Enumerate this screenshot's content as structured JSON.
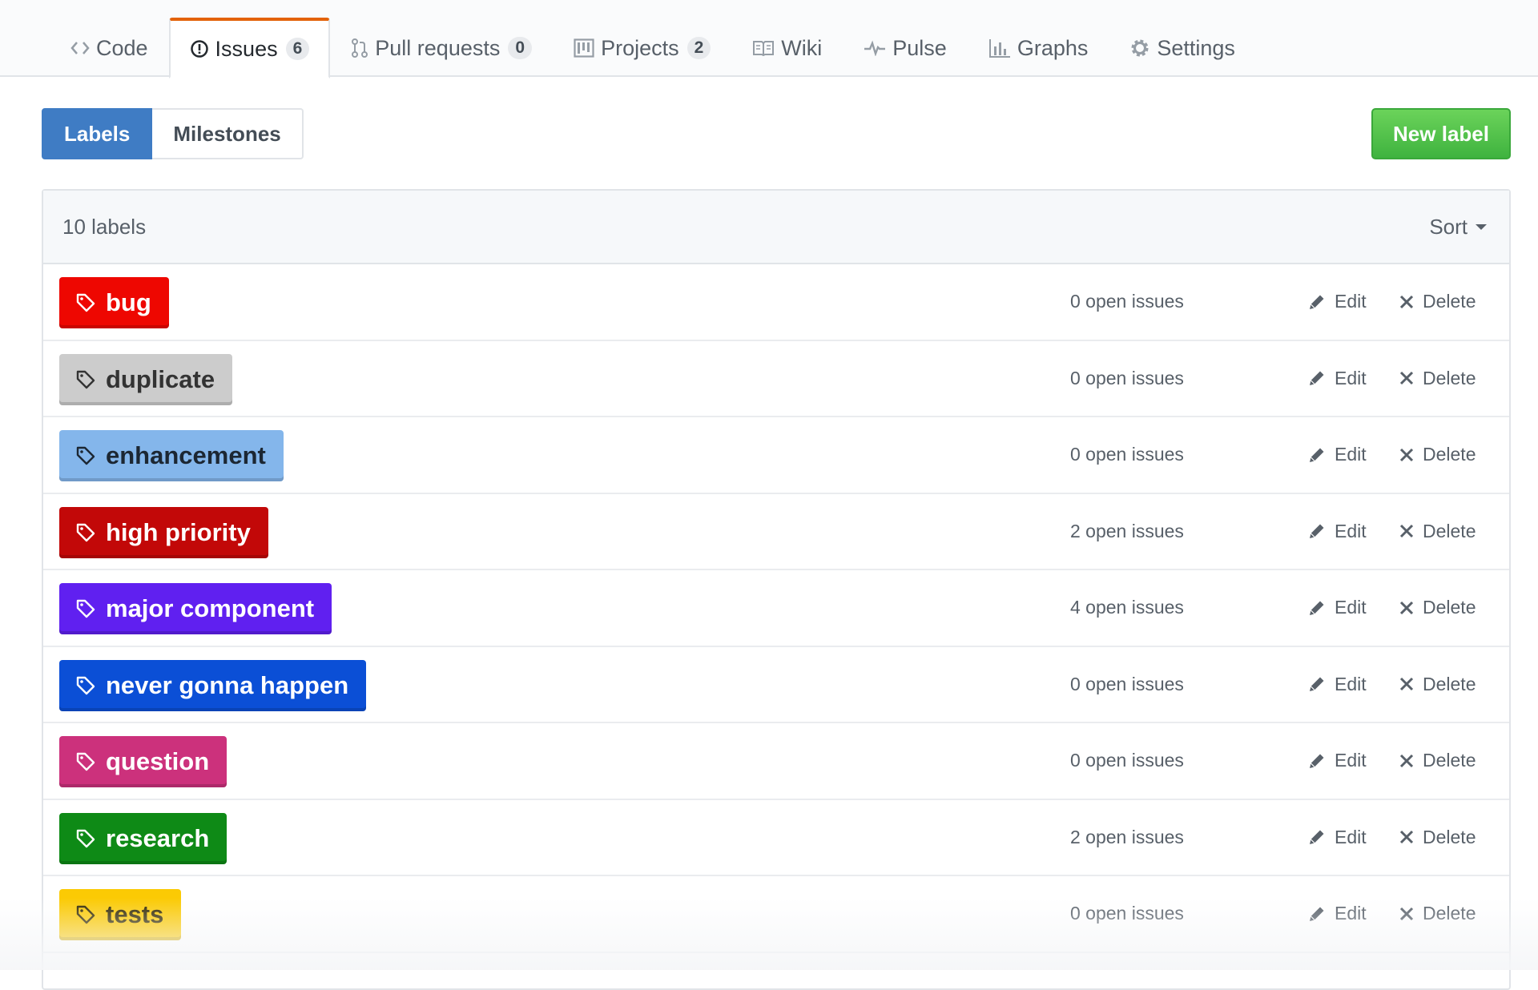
{
  "nav": {
    "tabs": [
      {
        "label": "Code",
        "icon": "code-icon"
      },
      {
        "label": "Issues",
        "icon": "issue-opened-icon",
        "count": "6"
      },
      {
        "label": "Pull requests",
        "icon": "git-pull-request-icon",
        "count": "0"
      },
      {
        "label": "Projects",
        "icon": "project-icon",
        "count": "2"
      },
      {
        "label": "Wiki",
        "icon": "book-icon"
      },
      {
        "label": "Pulse",
        "icon": "pulse-icon"
      },
      {
        "label": "Graphs",
        "icon": "graph-icon"
      },
      {
        "label": "Settings",
        "icon": "gear-icon"
      }
    ]
  },
  "subnav": {
    "labels": "Labels",
    "milestones": "Milestones"
  },
  "new_label_button": "New label",
  "box": {
    "count": "10 labels",
    "sort": "Sort"
  },
  "labels": [
    {
      "name": "bug",
      "issues": "0 open issues",
      "color": "#ee0701",
      "text_color": "#ffffff"
    },
    {
      "name": "duplicate",
      "issues": "0 open issues",
      "color": "#cccccc",
      "text_color": "#333333"
    },
    {
      "name": "enhancement",
      "issues": "0 open issues",
      "color": "#84b6eb",
      "text_color": "#1c2733"
    },
    {
      "name": "high priority",
      "issues": "2 open issues",
      "color": "#c20808",
      "text_color": "#ffffff"
    },
    {
      "name": "major component",
      "issues": "4 open issues",
      "color": "#6020f0",
      "text_color": "#ffffff"
    },
    {
      "name": "never gonna happen",
      "issues": "0 open issues",
      "color": "#0b4fd6",
      "text_color": "#ffffff"
    },
    {
      "name": "question",
      "issues": "0 open issues",
      "color": "#cc317c",
      "text_color": "#ffffff"
    },
    {
      "name": "research",
      "issues": "2 open issues",
      "color": "#0e8a16",
      "text_color": "#ffffff"
    },
    {
      "name": "tests",
      "issues": "0 open issues",
      "color": "#fbca04",
      "text_color": "#332900"
    }
  ],
  "actions": {
    "edit": "Edit",
    "delete": "Delete"
  }
}
